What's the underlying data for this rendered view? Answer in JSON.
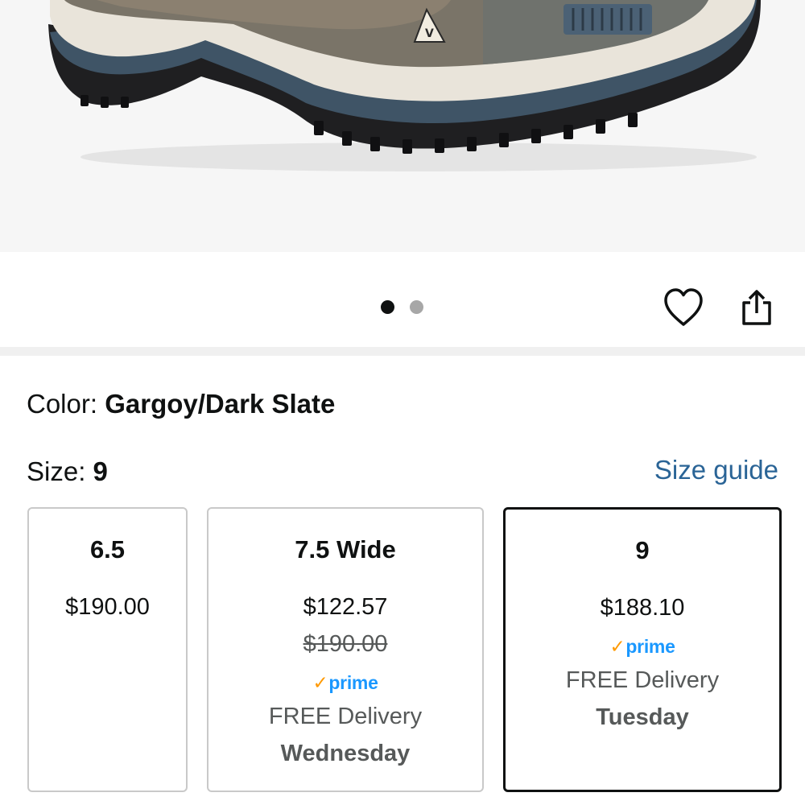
{
  "product": {
    "color_label": "Color: ",
    "color_value": "Gargoy/Dark Slate",
    "size_label": "Size: ",
    "size_value": "9",
    "size_guide_label": "Size guide"
  },
  "gallery": {
    "dot_count": 2,
    "active_index": 0
  },
  "actions": {
    "heart_icon": "heart-icon",
    "share_icon": "share-icon"
  },
  "sizes": [
    {
      "size": "6.5",
      "price": "$190.00",
      "list_price": "",
      "prime": "",
      "delivery": "",
      "day": "",
      "selected": false
    },
    {
      "size": "7.5 Wide",
      "price": "$122.57",
      "list_price": "$190.00",
      "prime": "prime",
      "delivery": "FREE Delivery",
      "day": "Wednesday",
      "selected": false
    },
    {
      "size": "9",
      "price": "$188.10",
      "list_price": "",
      "prime": "prime",
      "delivery": "FREE Delivery",
      "day": "Tuesday",
      "selected": true
    }
  ],
  "colors": {
    "link": "#2a6496",
    "prime_blue": "#1a98ff",
    "prime_check": "#ff9900",
    "selected_border": "#0f1111"
  }
}
